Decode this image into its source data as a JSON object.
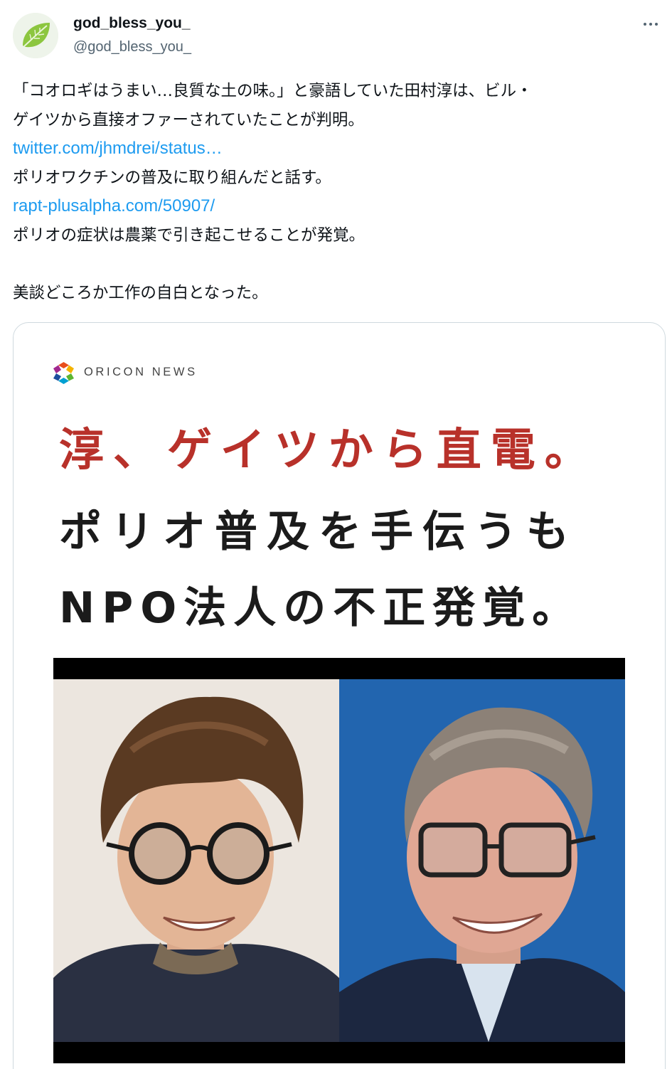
{
  "author": {
    "display_name": "god_bless_you_",
    "handle": "@god_bless_you_",
    "avatar_icon": "leaf-icon"
  },
  "tweet": {
    "lines": [
      "「コオロギはうまい…良質な土の味。」と豪語していた田村淳は、ビル・",
      "ゲイツから直接オファーされていたことが判明。"
    ],
    "link1": "twitter.com/jhmdrei/status…",
    "line3": "ポリオワクチンの普及に取り組んだと話す。",
    "link2": "rapt-plusalpha.com/50907/",
    "line5": "ポリオの症状は農薬で引き起こせることが発覚。",
    "line6": "美談どころか工作の自白となった。"
  },
  "card": {
    "brand": "ORICON NEWS",
    "headline_red": "淳、ゲイツから直電。",
    "headline_line2": "ポリオ普及を手伝うも",
    "headline_line3": "NPO法人の不正発覚。"
  },
  "colors": {
    "link": "#1d9bf0",
    "headline_red": "#b8312a",
    "secondary_text": "#536471"
  }
}
